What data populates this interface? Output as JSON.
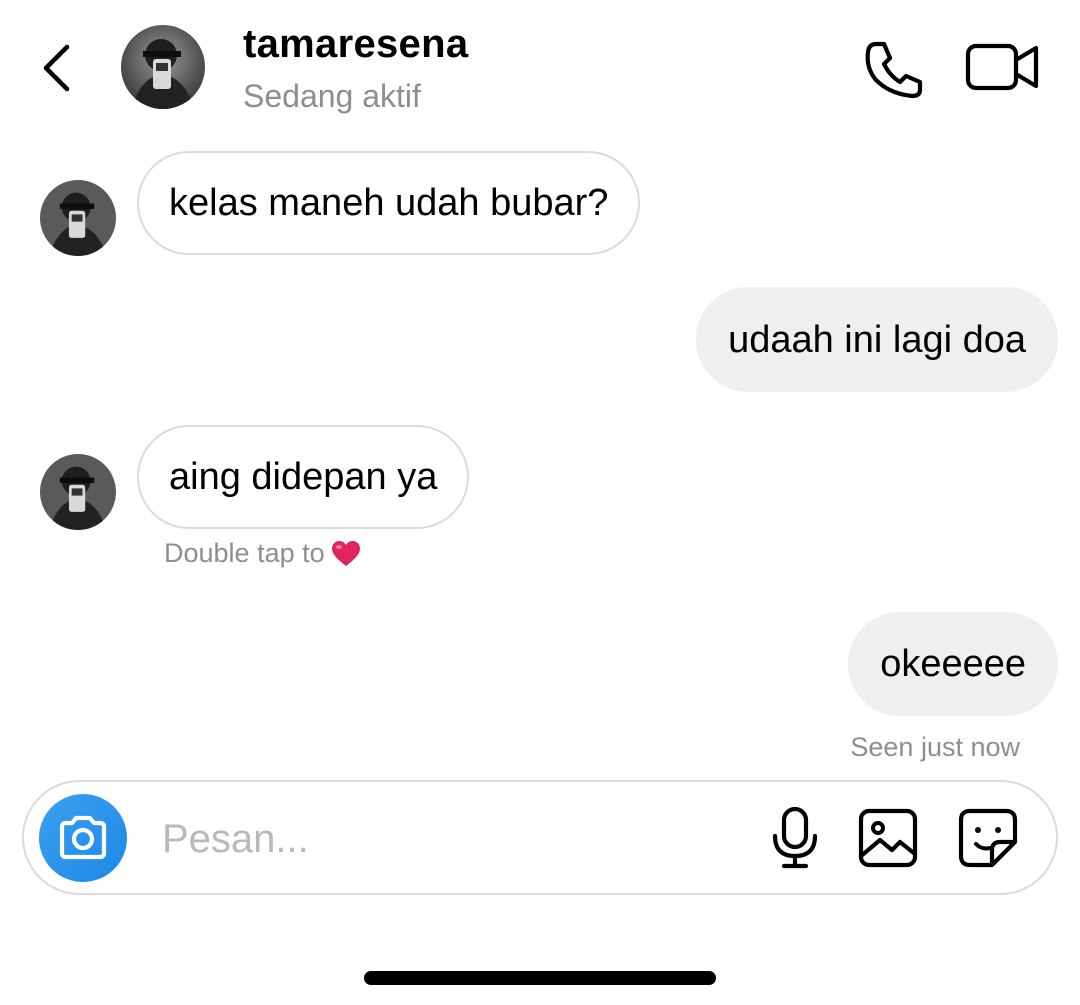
{
  "header": {
    "name": "tamaresena",
    "status": "Sedang aktif"
  },
  "messages": [
    {
      "direction": "incoming",
      "text": "kelas maneh udah bubar?"
    },
    {
      "direction": "outgoing",
      "text": "udaah ini lagi doa"
    },
    {
      "direction": "incoming",
      "text": "aing didepan ya",
      "hint": "Double tap to"
    },
    {
      "direction": "outgoing",
      "text": "okeeeee",
      "status": "Seen just now"
    }
  ],
  "composer": {
    "placeholder": "Pesan..."
  },
  "icons": {
    "back": "chevron-left-icon",
    "call": "phone-icon",
    "video": "video-camera-icon",
    "camera": "camera-icon",
    "mic": "microphone-icon",
    "gallery": "image-icon",
    "sticker": "sticker-icon",
    "heart": "heart-icon"
  },
  "colors": {
    "accent": "#1e88e5",
    "heart": "#e0245e",
    "muted_text": "#8e8e8e",
    "bubble_out": "#efefef",
    "border": "#dbdbdb"
  }
}
